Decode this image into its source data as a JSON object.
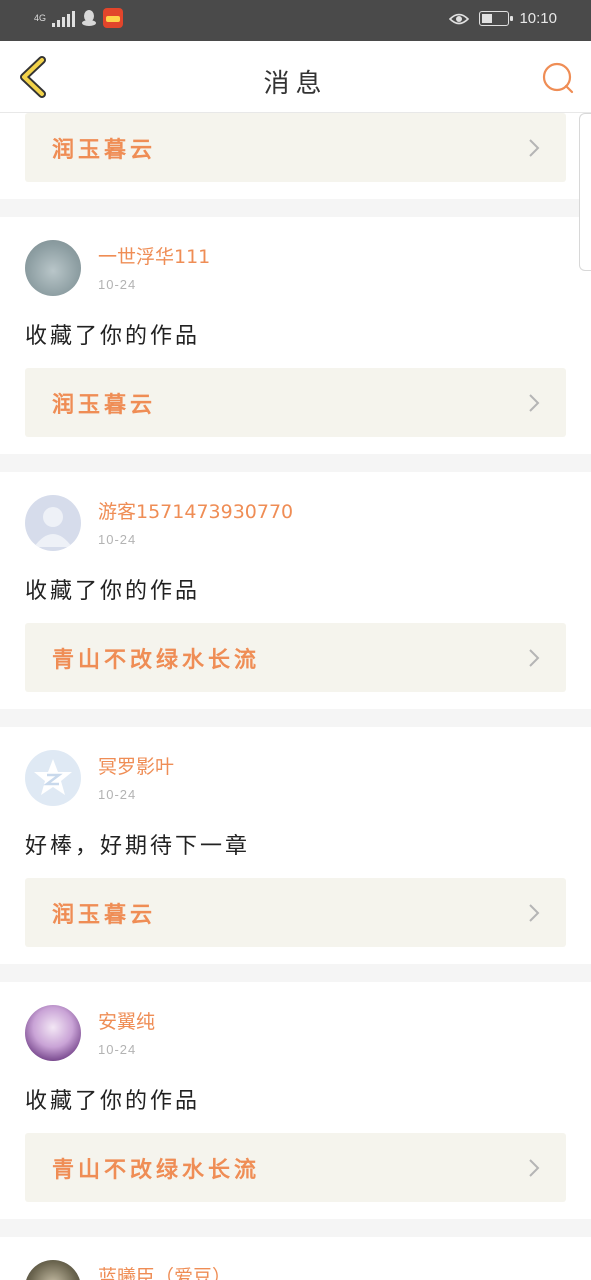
{
  "status_bar": {
    "network": "4G",
    "time": "10:10"
  },
  "header": {
    "title": "消息",
    "back_icon": "chevron-left-icon",
    "search_icon": "search-icon"
  },
  "colors": {
    "accent": "#ef8d55",
    "work_bg": "#f5f4ed",
    "header_bg": "#ffffff",
    "status_bg": "#4a4a4a",
    "back_icon": "#f3d34a"
  },
  "top_partial": {
    "work_title": "润玉暮云"
  },
  "messages": [
    {
      "user": "一世浮华111",
      "date": "10-24",
      "text": "收藏了你的作品",
      "work_title": "润玉暮云"
    },
    {
      "user": "游客1571473930770",
      "date": "10-24",
      "text": "收藏了你的作品",
      "work_title": "青山不改绿水长流"
    },
    {
      "user": "冥罗影叶",
      "date": "10-24",
      "text": "好棒，好期待下一章",
      "work_title": "润玉暮云"
    },
    {
      "user": "安翼纯",
      "date": "10-24",
      "text": "收藏了你的作品",
      "work_title": "青山不改绿水长流"
    },
    {
      "user": "蓝曦臣（爱豆）"
    }
  ]
}
